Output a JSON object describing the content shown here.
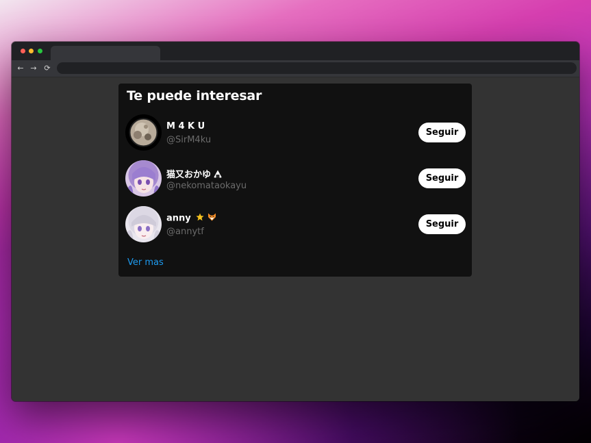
{
  "browser": {
    "tab_title": "",
    "address": "",
    "nav": {
      "back_icon": "arrow-left-icon",
      "forward_icon": "arrow-right-icon",
      "reload_icon": "reload-icon",
      "back_glyph": "←",
      "forward_glyph": "→",
      "reload_glyph": "⟳"
    }
  },
  "widget": {
    "title": "Te puede interesar",
    "see_more": "Ver mas",
    "users": [
      {
        "name": "M 4 K U",
        "handle": "@SirM4ku",
        "follow_label": "Seguir",
        "avatar": "moon-avatar"
      },
      {
        "name": "猫又おかゆ",
        "name_emoji": "onigiri-icon",
        "handle": "@nekomataokayu",
        "follow_label": "Seguir",
        "avatar": "anime-purple-hair-avatar"
      },
      {
        "name": "anny",
        "name_emoji": "star-icon fox-icon",
        "handle": "@annytf",
        "follow_label": "Seguir",
        "avatar": "anime-white-hair-avatar"
      }
    ]
  },
  "colors": {
    "card_bg": "#111111",
    "page_bg": "#333333",
    "link": "#1d9bf0",
    "handle": "#6b6b6b"
  }
}
